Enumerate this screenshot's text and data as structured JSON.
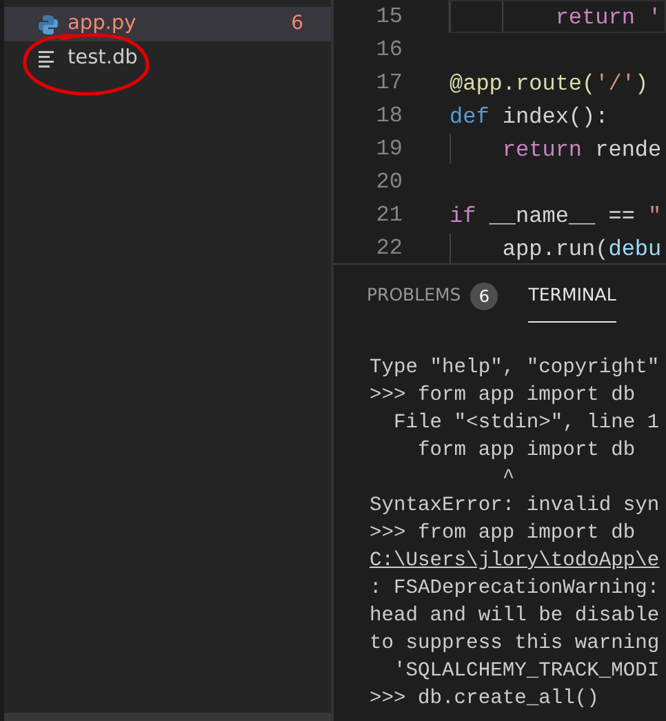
{
  "sidebar": {
    "files": [
      {
        "name": "app.py",
        "kind": "python",
        "selected": true,
        "errors": "6"
      },
      {
        "name": "test.db",
        "kind": "text",
        "selected": false
      }
    ],
    "annotations": [
      {
        "kind": "ellipse"
      }
    ]
  },
  "editor": {
    "lines": [
      {
        "number": "15",
        "current": true,
        "tokens": [
          {
            "text": "        return '",
            "kind": "keyword"
          }
        ]
      },
      {
        "number": "16",
        "current": false
      },
      {
        "number": "17",
        "current": false,
        "tokens": [
          {
            "text": "@app.route(",
            "kind": "function"
          },
          {
            "text": "'/'",
            "kind": "string"
          },
          {
            "text": ")",
            "kind": "function"
          }
        ]
      },
      {
        "number": "18",
        "current": false,
        "tokens": [
          {
            "text": "def",
            "kind": "storage"
          },
          {
            "text": " index():",
            "kind": "plain"
          }
        ]
      },
      {
        "number": "19",
        "current": false,
        "tokens": [
          {
            "text": "    return",
            "kind": "keyword"
          },
          {
            "text": " rende",
            "kind": "plain"
          }
        ]
      },
      {
        "number": "20",
        "current": false
      },
      {
        "number": "21",
        "current": false,
        "tokens": [
          {
            "text": "if",
            "kind": "keyword"
          },
          {
            "text": " __name__ == ",
            "kind": "plain"
          },
          {
            "text": "\"",
            "kind": "string"
          }
        ]
      },
      {
        "number": "22",
        "current": false,
        "tokens": [
          {
            "text": "    app.run(",
            "kind": "plain"
          },
          {
            "text": "debu",
            "kind": "param"
          }
        ]
      }
    ]
  },
  "panel": {
    "tabs": [
      {
        "label": "PROBLEMS",
        "badge": "6",
        "selected": false
      },
      {
        "label": "TERMINAL",
        "selected": true
      }
    ],
    "terminal": [
      {
        "text": "Type \"help\", \"copyright\"",
        "kind": "plain"
      },
      {
        "text": ">>> form app import db",
        "kind": "plain"
      },
      {
        "text": "  File \"<stdin>\", line 1",
        "kind": "plain"
      },
      {
        "text": "    form app import db",
        "kind": "plain"
      },
      {
        "text": "           ^",
        "kind": "plain"
      },
      {
        "text": "SyntaxError: invalid syn",
        "kind": "plain"
      },
      {
        "text": ">>> from app import db",
        "kind": "plain"
      },
      {
        "text": "C:\\Users\\jlory\\todoApp\\e",
        "kind": "link"
      },
      {
        "text": ": FSADeprecationWarning:",
        "kind": "plain"
      },
      {
        "text": "head and will be disable",
        "kind": "plain"
      },
      {
        "text": "to suppress this warning",
        "kind": "plain"
      },
      {
        "text": "  'SQLALCHEMY_TRACK_MODI",
        "kind": "plain"
      },
      {
        "text": ">>> db.create_all()",
        "kind": "plain"
      }
    ]
  }
}
